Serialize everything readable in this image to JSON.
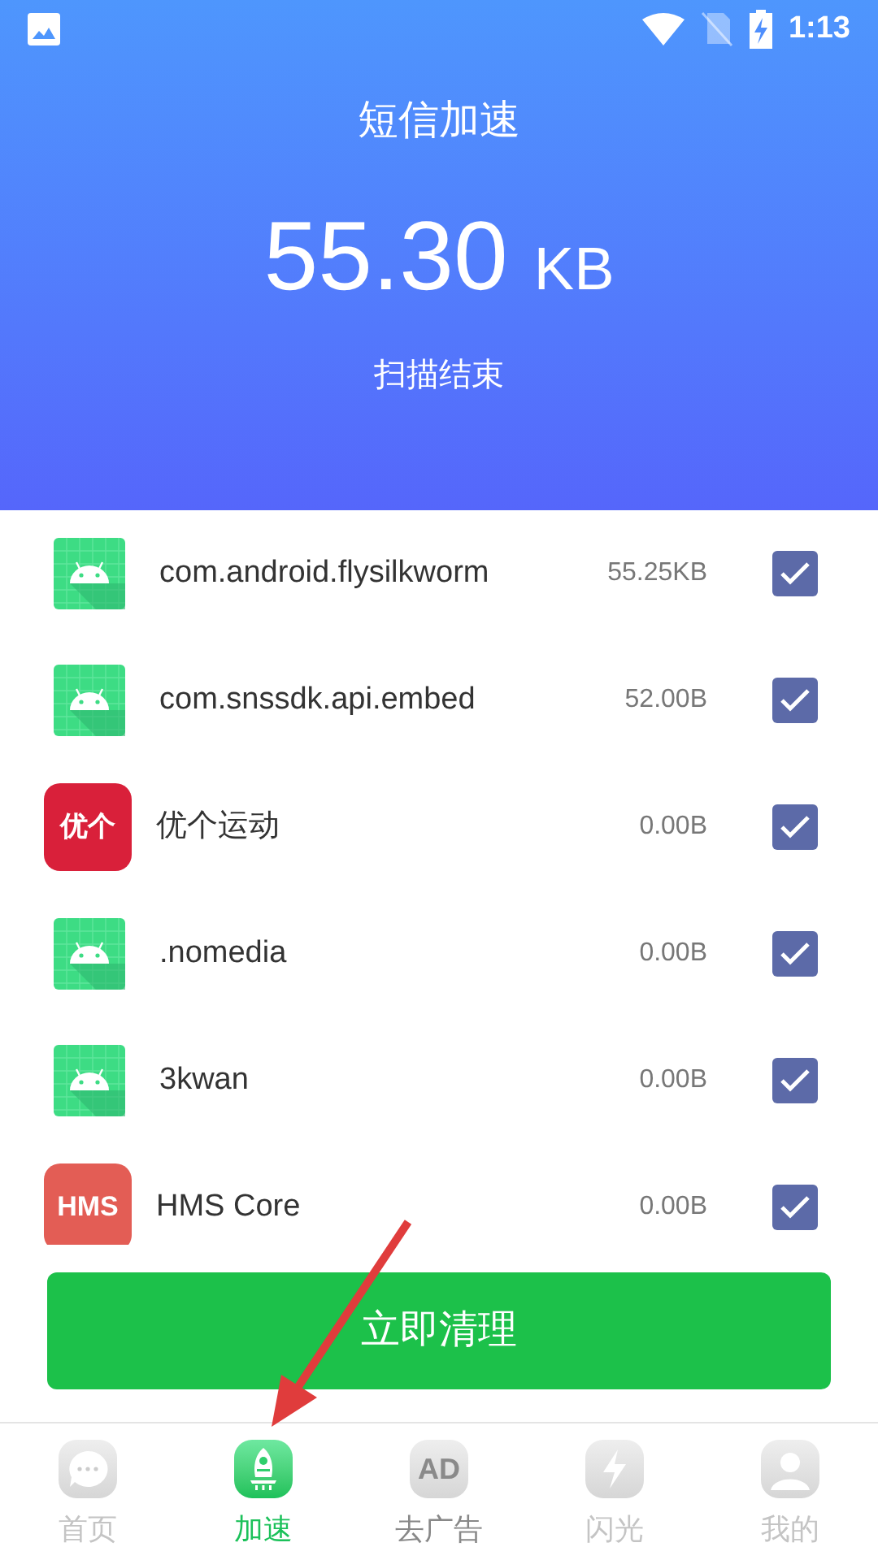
{
  "status_bar": {
    "time": "1:13"
  },
  "header": {
    "title": "短信加速",
    "size_value": "55.30",
    "size_unit": "KB",
    "status": "扫描结束"
  },
  "apps": [
    {
      "kind": "android",
      "name": "com.android.flysilkworm",
      "size": "55.25KB",
      "checked": true
    },
    {
      "kind": "android",
      "name": "com.snssdk.api.embed",
      "size": "52.00B",
      "checked": true
    },
    {
      "kind": "logo",
      "logo_text": "优个",
      "color": "#d9203a",
      "name": "优个运动",
      "size": "0.00B",
      "checked": true
    },
    {
      "kind": "android",
      "name": ".nomedia",
      "size": "0.00B",
      "checked": true
    },
    {
      "kind": "android",
      "name": "3kwan",
      "size": "0.00B",
      "checked": true
    },
    {
      "kind": "logo",
      "logo_text": "HMS",
      "color": "#e35d55",
      "name": "HMS Core",
      "size": "0.00B",
      "checked": true
    }
  ],
  "clean_button": "立即清理",
  "nav": [
    {
      "kind": "chat",
      "label": "首页",
      "selected": false
    },
    {
      "kind": "rocket",
      "label": "加速",
      "selected": true
    },
    {
      "kind": "ad",
      "icon_text": "AD",
      "label": "去广告",
      "selected": false
    },
    {
      "kind": "bolt",
      "label": "闪光",
      "selected": false
    },
    {
      "kind": "user",
      "label": "我的",
      "selected": false
    }
  ]
}
